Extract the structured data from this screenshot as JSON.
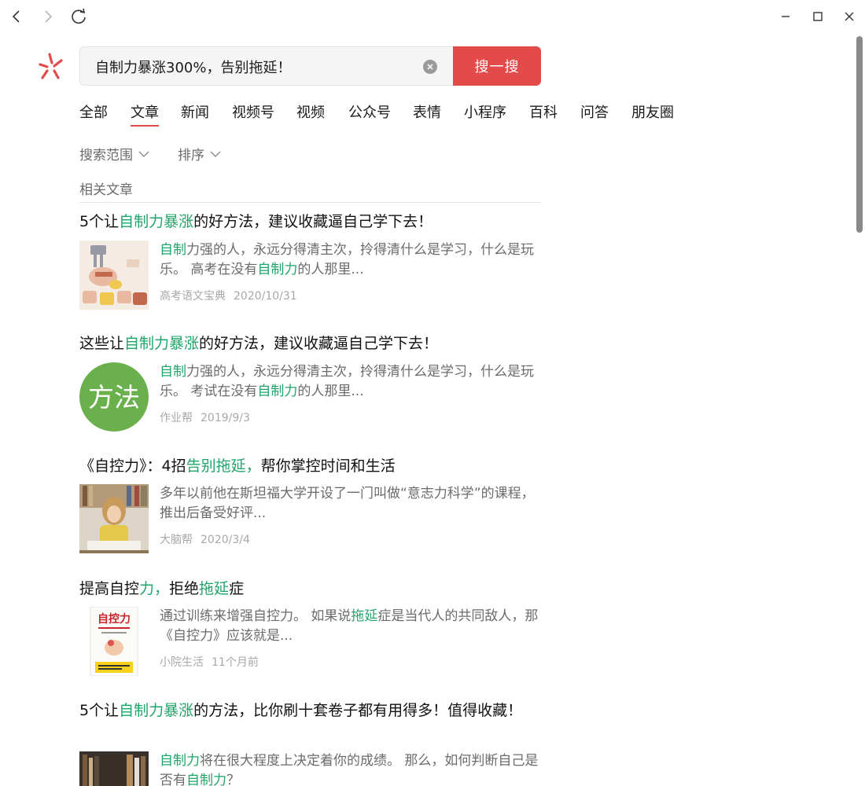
{
  "search": {
    "query": "自制力暴涨300%，告别拖延！",
    "button_label": "搜一搜"
  },
  "tabs": [
    {
      "label": "全部"
    },
    {
      "label": "文章"
    },
    {
      "label": "新闻"
    },
    {
      "label": "视频号"
    },
    {
      "label": "视频"
    },
    {
      "label": "公众号"
    },
    {
      "label": "表情"
    },
    {
      "label": "小程序"
    },
    {
      "label": "百科"
    },
    {
      "label": "问答"
    },
    {
      "label": "朋友圈"
    }
  ],
  "active_tab": "文章",
  "filters": {
    "scope_label": "搜索范围",
    "sort_label": "排序"
  },
  "section_label": "相关文章",
  "results": [
    {
      "title": [
        {
          "t": "5个让",
          "h": false
        },
        {
          "t": "自制力暴涨",
          "h": true
        },
        {
          "t": "的好方法，建议收藏逼自己学下去！",
          "h": false
        }
      ],
      "snippet": [
        {
          "t": "自制",
          "h": true
        },
        {
          "t": "力强的人，永远分得清主次，拎得清什么是学习，什么是玩乐。 高考在没有",
          "h": false
        },
        {
          "t": "自制力",
          "h": true
        },
        {
          "t": "的人那里...",
          "h": false
        }
      ],
      "source": "高考语文宝典",
      "date": "2020/10/31",
      "thumb_text": ""
    },
    {
      "title": [
        {
          "t": "这些让",
          "h": false
        },
        {
          "t": "自制力暴涨",
          "h": true
        },
        {
          "t": "的好方法，建议收藏逼自己学下去！",
          "h": false
        }
      ],
      "snippet": [
        {
          "t": "自制",
          "h": true
        },
        {
          "t": "力强的人，永远分得清主次，拎得清什么是学习，什么是玩乐。 考试在没有",
          "h": false
        },
        {
          "t": "自制力",
          "h": true
        },
        {
          "t": "的人那里...",
          "h": false
        }
      ],
      "source": "作业帮",
      "date": "2019/9/3",
      "thumb_text": "方法"
    },
    {
      "title": [
        {
          "t": "《自控力》：4招",
          "h": false
        },
        {
          "t": "告别拖延，",
          "h": true
        },
        {
          "t": "帮你掌控时间和生活",
          "h": false
        }
      ],
      "snippet": [
        {
          "t": "多年以前他在斯坦福大学开设了一门叫做“意志力科学”的课程，推出后备受好评...",
          "h": false
        }
      ],
      "source": "大脑帮",
      "date": "2020/3/4",
      "thumb_text": ""
    },
    {
      "title": [
        {
          "t": "提高自控",
          "h": false
        },
        {
          "t": "力，",
          "h": true
        },
        {
          "t": "拒绝",
          "h": false
        },
        {
          "t": "拖延",
          "h": true
        },
        {
          "t": "症",
          "h": false
        }
      ],
      "snippet": [
        {
          "t": "通过训练来增强自控力。 如果说",
          "h": false
        },
        {
          "t": "拖延",
          "h": true
        },
        {
          "t": "症是当代人的共同敌人，那《自控力》应该就是...",
          "h": false
        }
      ],
      "source": "小院生活",
      "date": "11个月前",
      "thumb_text": "自控力"
    },
    {
      "title": [
        {
          "t": "5个让",
          "h": false
        },
        {
          "t": "自制力暴涨",
          "h": true
        },
        {
          "t": "的方法，比你刷十套卷子都有用得多！值得收藏！",
          "h": false
        }
      ],
      "snippet": [
        {
          "t": "自制力",
          "h": true
        },
        {
          "t": "将在很大程度上决定着你的成绩。 那么，如何判断自己是否有",
          "h": false
        },
        {
          "t": "自制力",
          "h": true
        },
        {
          "t": "？",
          "h": false
        }
      ],
      "source": "",
      "date": "",
      "thumb_text": ""
    }
  ],
  "colors": {
    "accent": "#e34b4b",
    "highlight": "#1fa46a",
    "muted": "#6b6b6b",
    "meta": "#a8a8a8"
  }
}
